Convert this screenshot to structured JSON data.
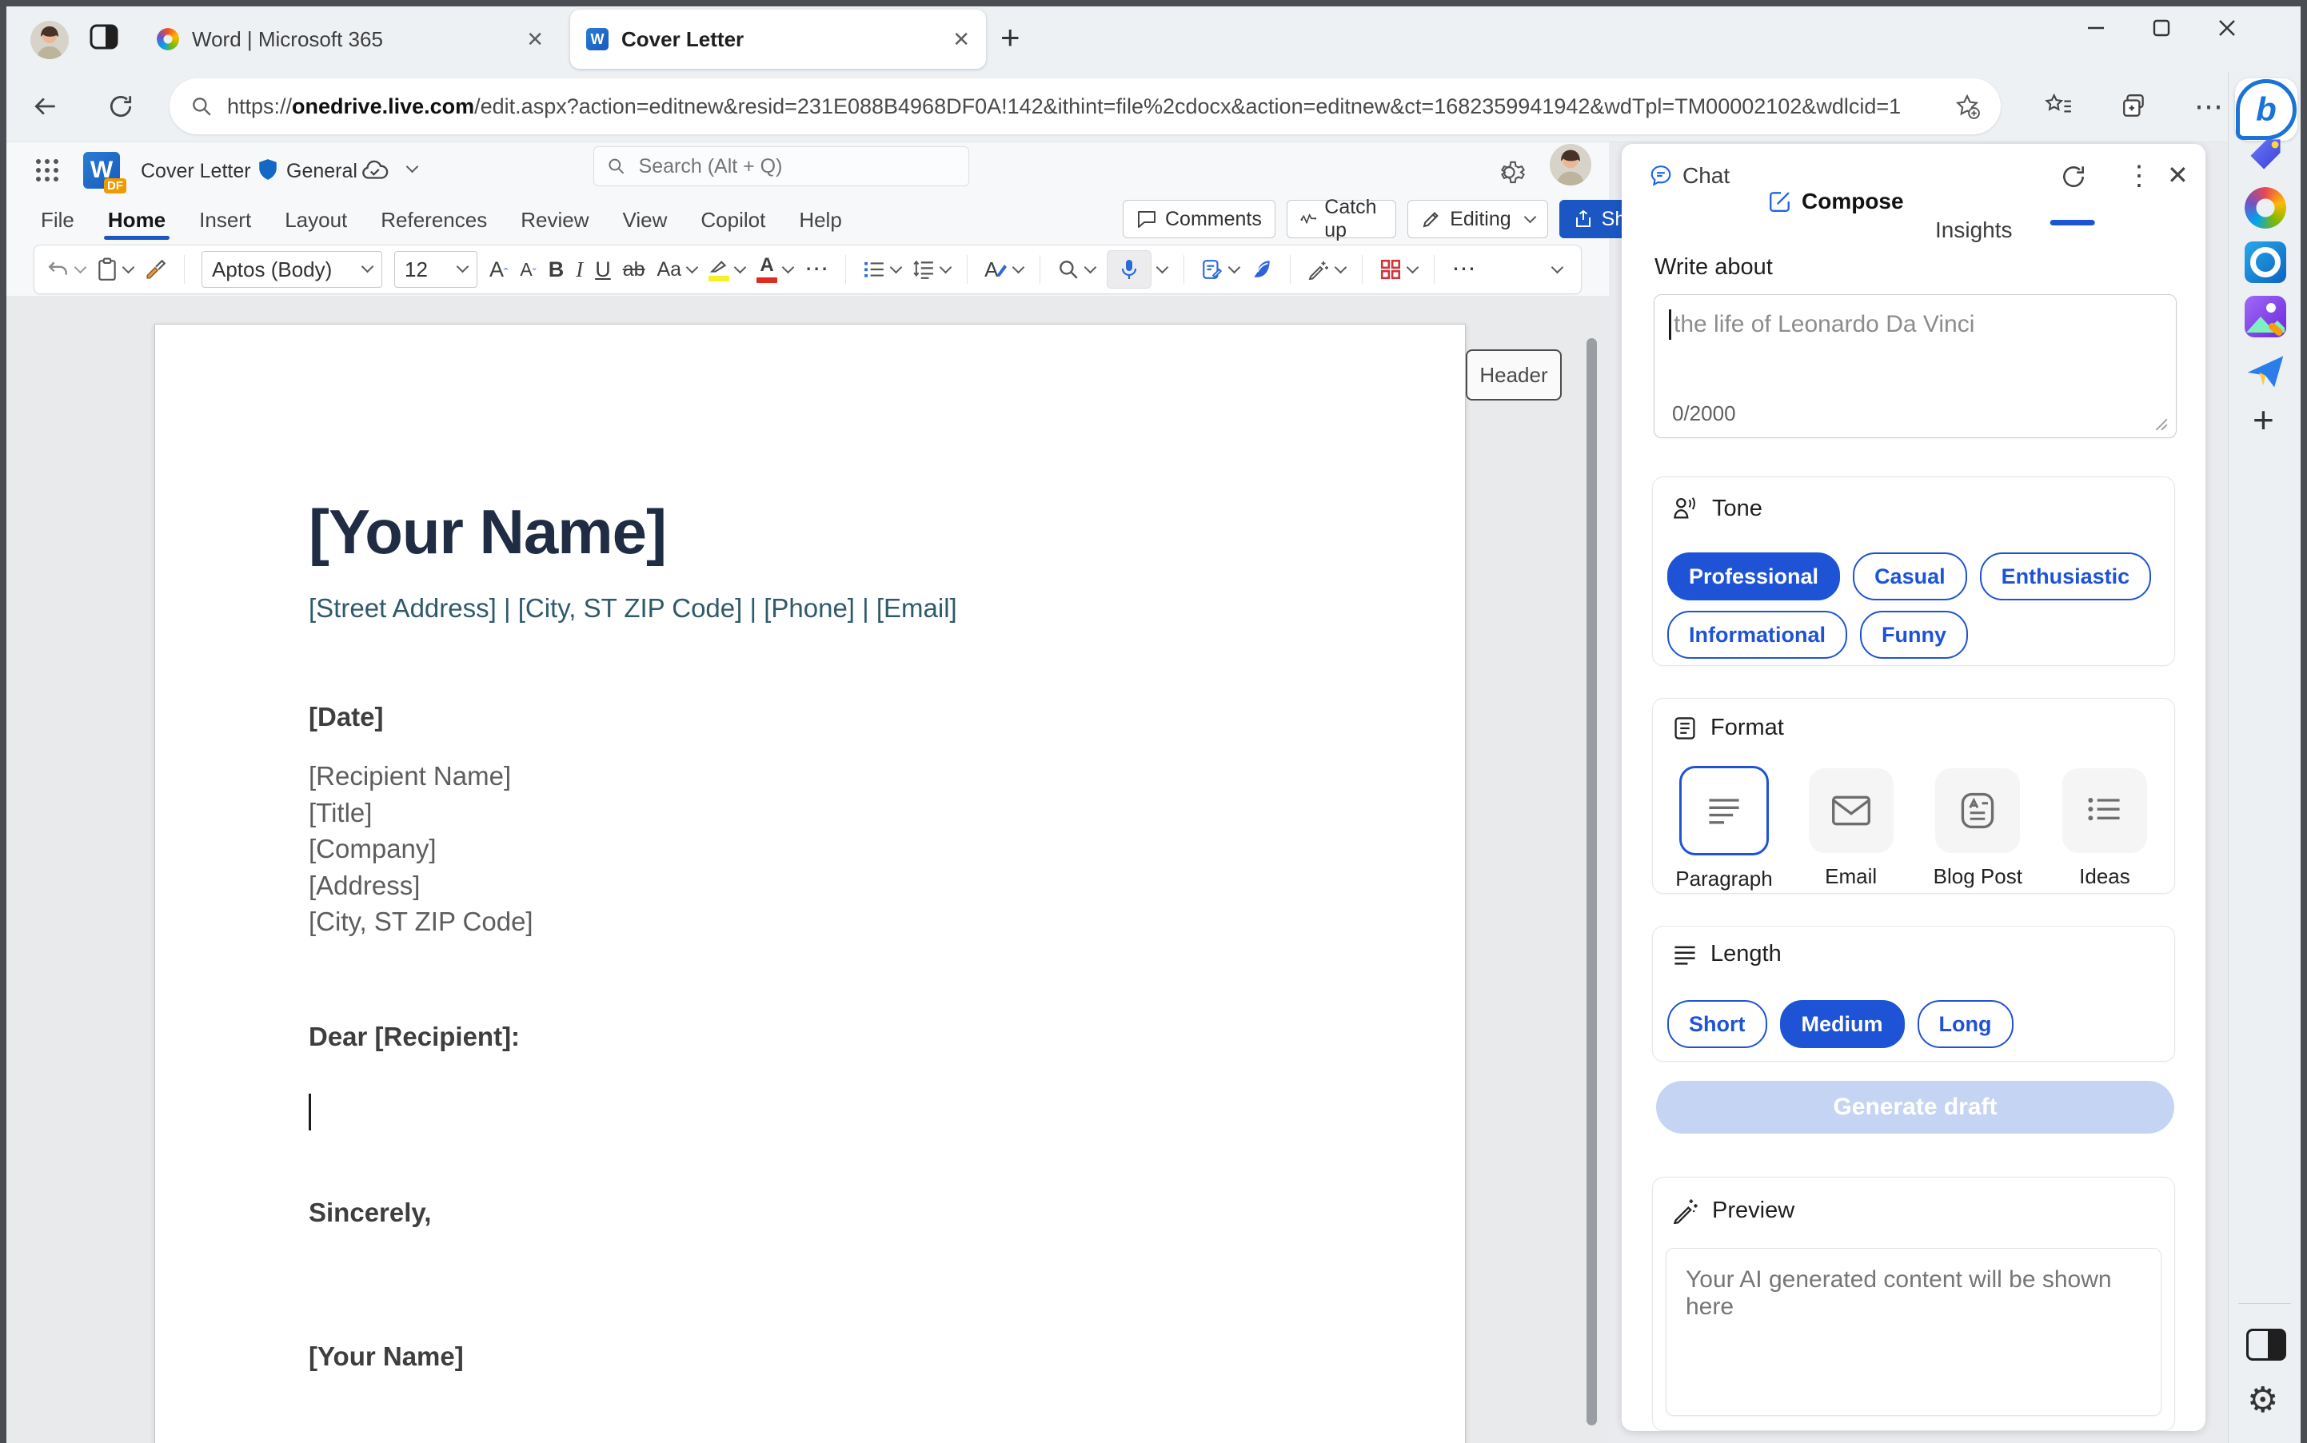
{
  "browser": {
    "tab1_title": "Word | Microsoft 365",
    "tab2_title": "Cover Letter",
    "url_prefix": "https://",
    "url_host": "onedrive.live.com",
    "url_rest": "/edit.aspx?action=editnew&resid=231E088B4968DF0A!142&ithint=file%2cdocx&action=editnew&ct=1682359941942&wdTpl=TM00002102&wdlcid=1"
  },
  "word": {
    "doc_title": "Cover Letter",
    "sensitivity_label": "General",
    "search_placeholder": "Search (Alt + Q)",
    "menus": [
      "File",
      "Home",
      "Insert",
      "Layout",
      "References",
      "Review",
      "View",
      "Copilot",
      "Help"
    ],
    "comments": "Comments",
    "catch_up": "Catch up",
    "editing": "Editing",
    "share": "Share",
    "font_name": "Aptos (Body)",
    "font_size": "12",
    "header_chip": "Header"
  },
  "document": {
    "name": "[Your Name]",
    "contact": "[Street Address] | [City, ST ZIP Code] | [Phone] | [Email]",
    "date": "[Date]",
    "line1": "[Recipient Name]",
    "line2": "[Title]",
    "line3": "[Company]",
    "line4": "[Address]",
    "line5": "[City, ST ZIP Code]",
    "salutation": "Dear [Recipient]:",
    "closing": "Sincerely,",
    "signature": "[Your Name]"
  },
  "sidebar": {
    "tab_chat": "Chat",
    "tab_compose": "Compose",
    "tab_insights": "Insights",
    "write_about_label": "Write about",
    "topic_placeholder": "the life of Leonardo Da Vinci",
    "char_counter": "0/2000",
    "tone_label": "Tone",
    "tones": [
      "Professional",
      "Casual",
      "Enthusiastic",
      "Informational",
      "Funny"
    ],
    "format_label": "Format",
    "formats": [
      "Paragraph",
      "Email",
      "Blog Post",
      "Ideas"
    ],
    "length_label": "Length",
    "lengths": [
      "Short",
      "Medium",
      "Long"
    ],
    "generate_button": "Generate draft",
    "preview_label": "Preview",
    "preview_placeholder": "Your AI generated content will be shown here"
  },
  "colors": {
    "accent_blue": "#1e53d6",
    "word_blue": "#1b57c2",
    "disabled_generate": "#c6d4f4",
    "doc_heading": "#202c44",
    "doc_contact": "#2f5a6c"
  }
}
